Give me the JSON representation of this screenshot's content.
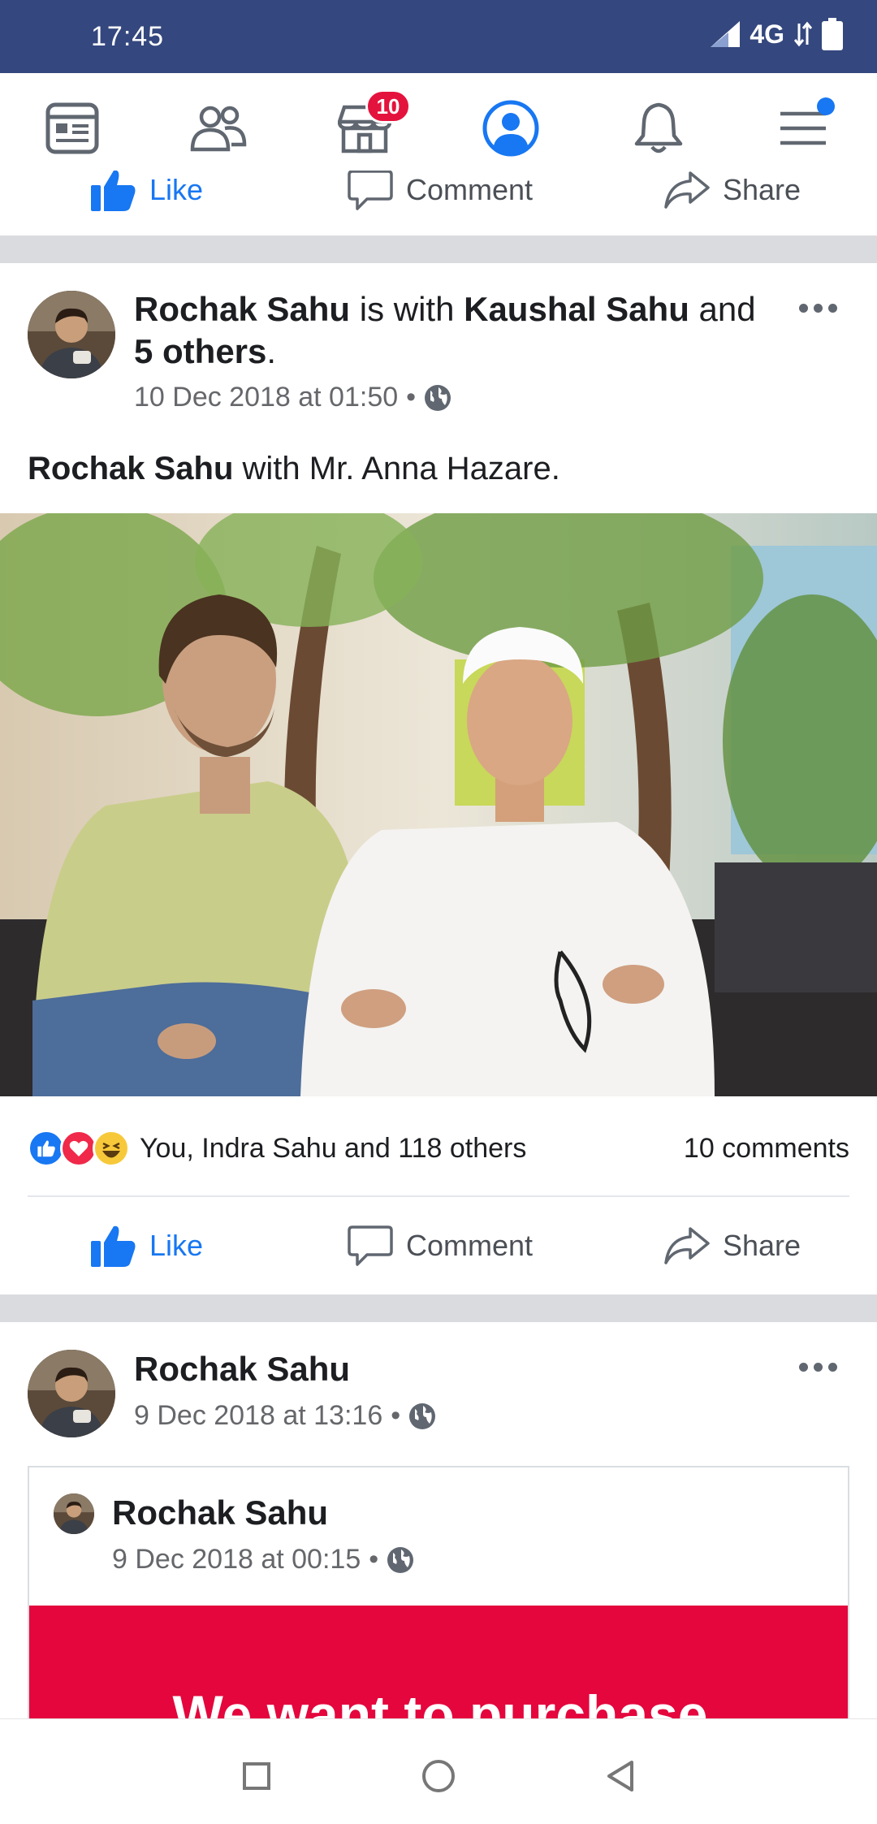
{
  "status_bar": {
    "time": "17:45",
    "network": "4G"
  },
  "nav": {
    "marketplace_badge": "10",
    "items": [
      "news-feed",
      "friends",
      "marketplace",
      "profile",
      "notifications",
      "menu"
    ]
  },
  "partial_actions": {
    "like": "Like",
    "comment": "Comment",
    "share": "Share"
  },
  "post1": {
    "author": "Rochak Sahu",
    "with_text": " is with ",
    "tagged": "Kaushal Sahu",
    "and_text": " and",
    "others": "5 others",
    "period": ".",
    "timestamp": "10 Dec 2018 at 01:50",
    "dot": "•",
    "text_author": "Rochak Sahu",
    "text_rest": " with Mr. Anna Hazare.",
    "reactions_text": "You, Indra Sahu and 118 others",
    "comments_count": "10 comments",
    "actions": {
      "like": "Like",
      "comment": "Comment",
      "share": "Share"
    }
  },
  "post2": {
    "author": "Rochak Sahu",
    "timestamp": "9 Dec 2018 at 13:16",
    "dot": "•",
    "shared": {
      "author": "Rochak Sahu",
      "timestamp": "9 Dec 2018 at 00:15",
      "dot": "•",
      "banner_text": "We want to purchase"
    }
  },
  "colors": {
    "accent": "#1877f2",
    "status_bar": "#34477e",
    "badge": "#e4133d",
    "banner": "#e4063d"
  }
}
